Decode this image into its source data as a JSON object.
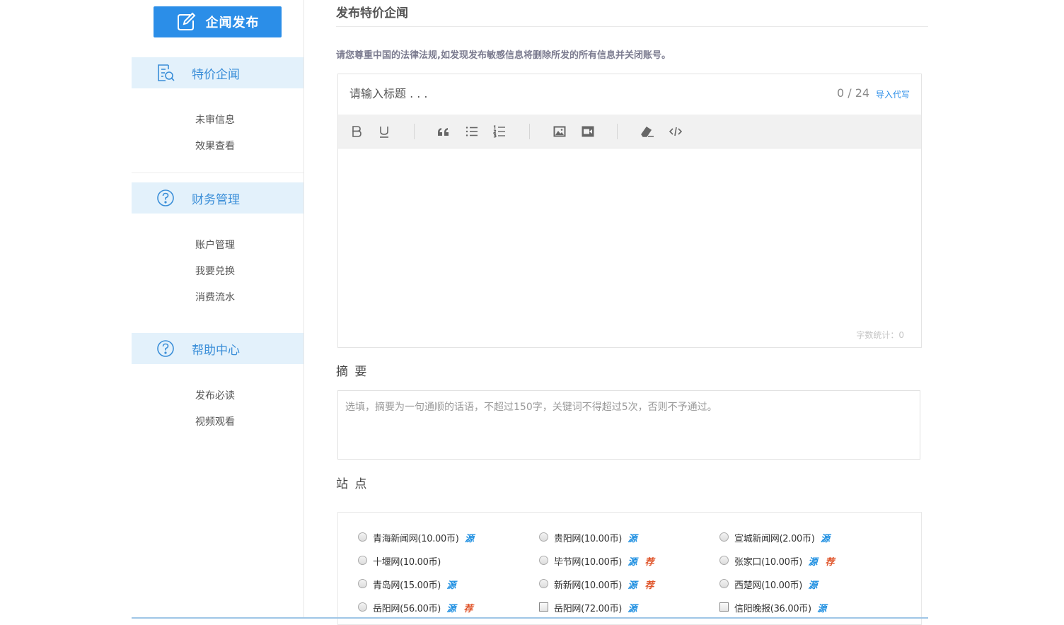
{
  "sidebar": {
    "publish_button": "企闻发布",
    "sections": [
      {
        "label": "特价企闻",
        "icon": "search-document-icon",
        "items": [
          "未审信息",
          "效果查看"
        ]
      },
      {
        "label": "财务管理",
        "icon": "question-circle-icon",
        "items": [
          "账户管理",
          "我要兑换",
          "消费流水"
        ]
      },
      {
        "label": "帮助中心",
        "icon": "question-circle-icon",
        "items": [
          "发布必读",
          "视频观看"
        ]
      }
    ]
  },
  "main": {
    "page_title": "发布特价企闻",
    "notice": "请您尊重中国的法律法规,如发现发布敏感信息将删除所发的所有信息并关闭账号。",
    "editor": {
      "title_placeholder": "请输入标题 . . .",
      "char_count": "0 / 24",
      "import_link": "导入代写",
      "word_count": "字数统计：0",
      "toolbar": [
        "bold",
        "underline",
        "quote",
        "bullet-list",
        "numbered-list",
        "image",
        "video",
        "eraser",
        "code"
      ]
    },
    "summary": {
      "label": "摘 要",
      "placeholder": "选填，摘要为一句通顺的话语，不超过150字，关键词不得超过5次，否则不予通过。"
    },
    "sites": {
      "label": "站 点",
      "badge_yuan": "源",
      "badge_jian": "荐",
      "list": [
        {
          "name": "青海新闻网(10.00币)",
          "input": "radio",
          "badges": [
            "yuan"
          ]
        },
        {
          "name": "贵阳网(10.00币)",
          "input": "radio",
          "badges": [
            "yuan"
          ]
        },
        {
          "name": "宣城新闻网(2.00币)",
          "input": "radio",
          "badges": [
            "yuan"
          ]
        },
        {
          "name": "十堰网(10.00币)",
          "input": "radio",
          "badges": []
        },
        {
          "name": "毕节网(10.00币)",
          "input": "radio",
          "badges": [
            "yuan",
            "jian"
          ]
        },
        {
          "name": "张家口(10.00币)",
          "input": "radio",
          "badges": [
            "yuan",
            "jian"
          ]
        },
        {
          "name": "青岛网(15.00币)",
          "input": "radio",
          "badges": [
            "yuan"
          ]
        },
        {
          "name": "新新网(10.00币)",
          "input": "radio",
          "badges": [
            "yuan",
            "jian"
          ]
        },
        {
          "name": "西楚网(10.00币)",
          "input": "radio",
          "badges": [
            "yuan"
          ]
        },
        {
          "name": "岳阳网(56.00币)",
          "input": "radio",
          "badges": [
            "yuan",
            "jian"
          ]
        },
        {
          "name": "岳阳网(72.00币)",
          "input": "checkbox",
          "badges": [
            "yuan"
          ]
        },
        {
          "name": "信阳晚报(36.00币)",
          "input": "checkbox",
          "badges": [
            "yuan"
          ]
        }
      ]
    }
  },
  "colors": {
    "accent": "#2b8ee8",
    "section_bg": "#e3f1fb",
    "badge_yuan": "#1e8fe1",
    "badge_jian": "#e0562c"
  }
}
